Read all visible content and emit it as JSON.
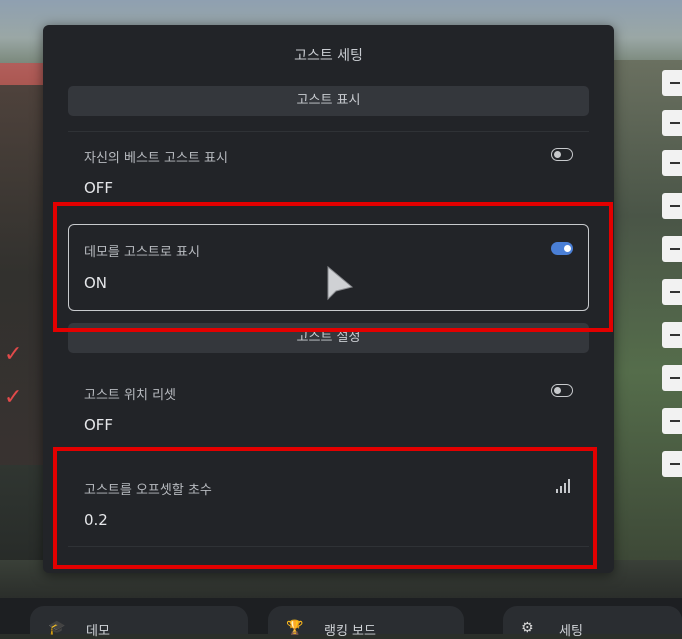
{
  "dialog": {
    "title": "고스트 세팅",
    "sections": [
      {
        "header": "고스트 표시"
      },
      {
        "header": "고스트 설정"
      }
    ],
    "rows": [
      {
        "label": "자신의 베스트 고스트 표시",
        "value": "OFF",
        "control": "toggle",
        "state": "off"
      },
      {
        "label": "데모를 고스트로 표시",
        "value": "ON",
        "control": "toggle",
        "state": "on",
        "selected": true
      },
      {
        "label": "고스트 위치 리셋",
        "value": "OFF",
        "control": "toggle",
        "state": "off"
      },
      {
        "label": "고스트를 오프셋할 초수",
        "value": "0.2",
        "control": "signal-icon"
      }
    ]
  },
  "bottom_bar": {
    "items": [
      {
        "label": "데모",
        "icon": "graduation-cap-icon"
      },
      {
        "label": "랭킹 보드",
        "icon": "trophy-icon"
      },
      {
        "label": "세팅",
        "icon": "gear-icon"
      }
    ]
  },
  "colors": {
    "dialog_bg": "#222428",
    "section_header_bg": "#34373c",
    "toggle_on": "#4a7fd6",
    "annotation_red": "#e30000"
  }
}
